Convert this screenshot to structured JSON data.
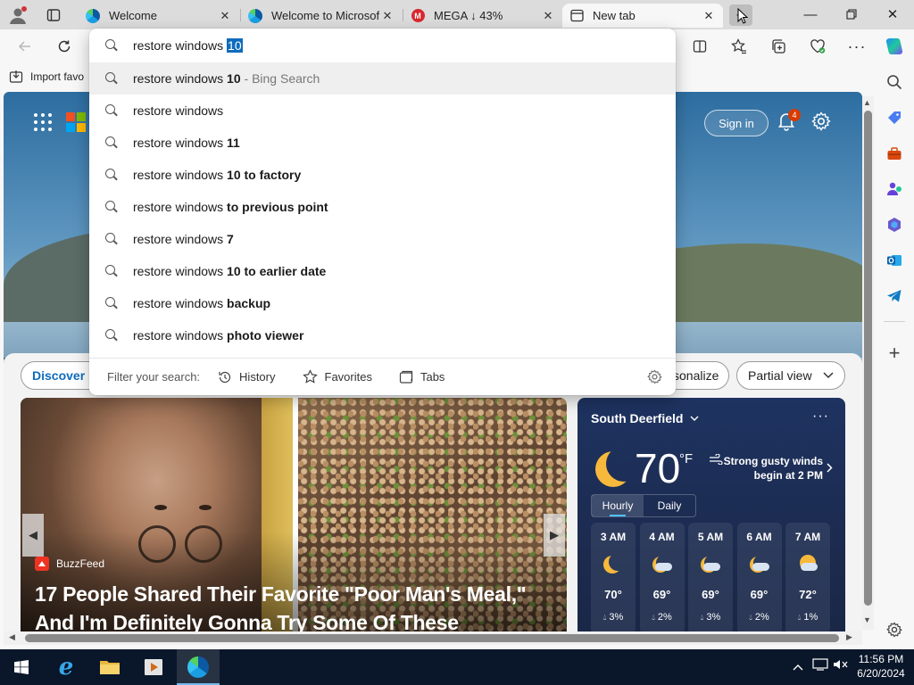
{
  "tabs": [
    {
      "title": "Welcome",
      "icon": "edge-icon"
    },
    {
      "title": "Welcome to Microsof",
      "icon": "edge-icon"
    },
    {
      "title": "MEGA ↓ 43%",
      "icon": "mega-icon"
    },
    {
      "title": "New tab",
      "icon": "newtab-icon",
      "active": true
    }
  ],
  "favbar": {
    "import_label": "Import favo"
  },
  "omnibox": {
    "typed": "restore windows ",
    "selected": "10"
  },
  "suggestions": [
    {
      "prefix": "restore windows ",
      "bold": "10",
      "suffix": " - Bing Search",
      "highlighted": true
    },
    {
      "prefix": "restore windows",
      "bold": "",
      "suffix": ""
    },
    {
      "prefix": "restore windows ",
      "bold": "11",
      "suffix": ""
    },
    {
      "prefix": "restore windows ",
      "bold": "10 to factory",
      "suffix": ""
    },
    {
      "prefix": "restore windows ",
      "bold": "to previous point",
      "suffix": ""
    },
    {
      "prefix": "restore windows ",
      "bold": "7",
      "suffix": ""
    },
    {
      "prefix": "restore windows ",
      "bold": "10 to earlier date",
      "suffix": ""
    },
    {
      "prefix": "restore windows ",
      "bold": "backup",
      "suffix": ""
    },
    {
      "prefix": "restore windows ",
      "bold": "photo viewer",
      "suffix": ""
    }
  ],
  "filter": {
    "label": "Filter your search:",
    "history": "History",
    "favorites": "Favorites",
    "tabs": "Tabs"
  },
  "newtab": {
    "signin": "Sign in",
    "notif_count": "4",
    "discover": "Discover",
    "personalize": "sonalize",
    "partial_view": "Partial view"
  },
  "news": {
    "source": "BuzzFeed",
    "headline": "17 People Shared Their Favorite \"Poor Man's Meal,\" And I'm Definitely Gonna Try Some Of These"
  },
  "weather": {
    "location": "South Deerfield",
    "temp": "70",
    "unit": "°F",
    "alert_line1": "Strong gusty winds",
    "alert_line2": "begin at 2 PM",
    "tab_hourly": "Hourly",
    "tab_daily": "Daily",
    "hours": [
      {
        "time": "3 AM",
        "icon": "moon-icon",
        "temp": "70°",
        "precip": "3%"
      },
      {
        "time": "4 AM",
        "icon": "cloudy-moon-icon",
        "temp": "69°",
        "precip": "2%"
      },
      {
        "time": "5 AM",
        "icon": "cloudy-moon-icon",
        "temp": "69°",
        "precip": "3%"
      },
      {
        "time": "6 AM",
        "icon": "partly-cloudy-moon-icon",
        "temp": "69°",
        "precip": "2%"
      },
      {
        "time": "7 AM",
        "icon": "partly-cloudy-icon",
        "temp": "72°",
        "precip": "1%"
      }
    ]
  },
  "taskbar": {
    "time": "11:56 PM",
    "date": "6/20/2024"
  },
  "colors": {
    "accent": "#0f6cbd",
    "taskbar": "#0a1629",
    "weather_bg": "#1e3361",
    "moon": "#f6b93b"
  }
}
